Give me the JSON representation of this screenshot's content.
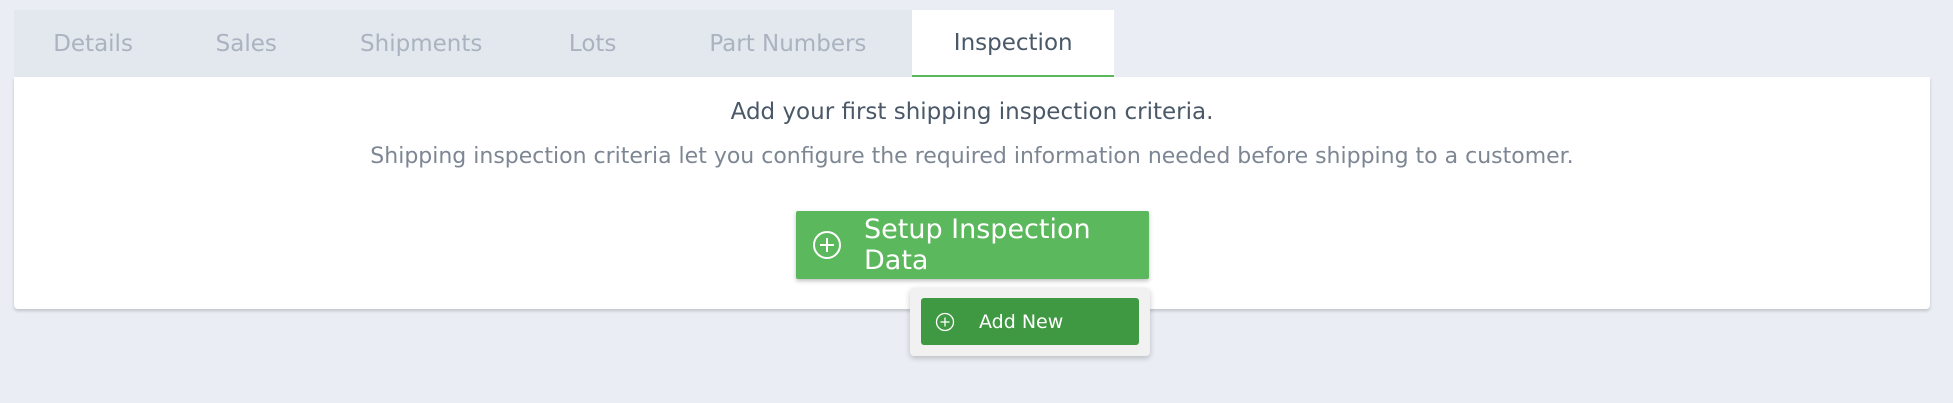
{
  "tabs": [
    {
      "label": "Details",
      "active": false
    },
    {
      "label": "Sales",
      "active": false
    },
    {
      "label": "Shipments",
      "active": false
    },
    {
      "label": "Lots",
      "active": false
    },
    {
      "label": "Part Numbers",
      "active": false
    },
    {
      "label": "Inspection",
      "active": true
    }
  ],
  "panel": {
    "headline": "Add your first shipping inspection criteria.",
    "subline": "Shipping inspection criteria let you configure the required information needed before shipping to a customer."
  },
  "setup_button": {
    "label": "Setup Inspection Data",
    "icon": "plus-circle-icon"
  },
  "dropdown": {
    "add_new_label": "Add New",
    "icon": "plus-circle-icon"
  },
  "colors": {
    "background": "#eaeef4",
    "accent_green": "#5cb85c",
    "dark_green": "#3f9842",
    "text_dark": "#4a5868",
    "text_muted": "#aab3bf"
  }
}
